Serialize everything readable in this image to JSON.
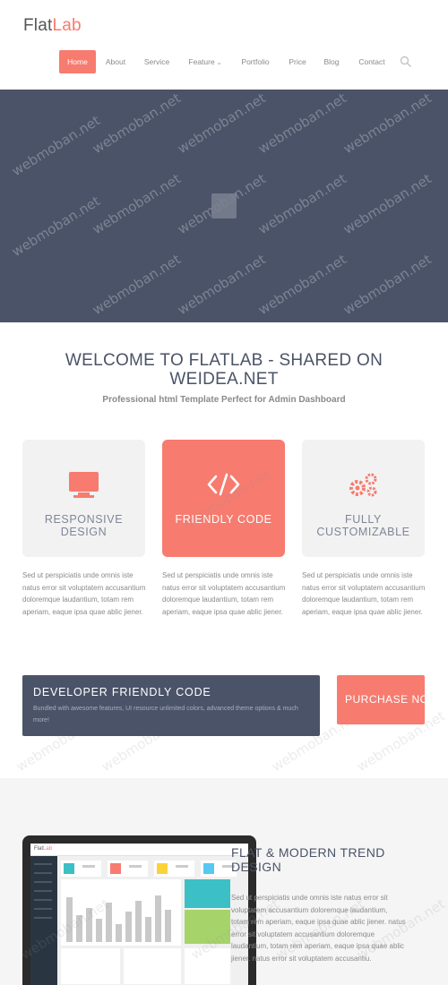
{
  "header": {
    "logo_main": "Flat",
    "logo_accent": "Lab",
    "nav": [
      {
        "label": "Home",
        "active": true
      },
      {
        "label": "About"
      },
      {
        "label": "Service"
      },
      {
        "label": "Feature",
        "has_dropdown": true
      },
      {
        "label": "Portfolio"
      },
      {
        "label": "Price"
      },
      {
        "label": "Blog"
      },
      {
        "label": "Contact"
      }
    ],
    "search_icon": "search-icon"
  },
  "watermark": "webmoban.net",
  "welcome": {
    "title": "WELCOME TO FLATLAB - SHARED ON WEIDEA.NET",
    "subtitle": "Professional html Template Perfect for Admin Dashboard"
  },
  "features": [
    {
      "title": "RESPONSIVE DESIGN",
      "icon": "monitor-icon",
      "highlighted": false,
      "text": "Sed ut perspiciatis unde omnis iste natus error sit voluptatem accusantium doloremque laudantium, totam rem aperiam, eaque ipsa quae ablic jiener."
    },
    {
      "title": "FRIENDLY CODE",
      "icon": "code-icon",
      "highlighted": true,
      "text": "Sed ut perspiciatis unde omnis iste natus error sit voluptatem accusantium doloremque laudantium, totam rem aperiam, eaque ipsa quae ablic jiener."
    },
    {
      "title": "FULLY CUSTOMIZABLE",
      "icon": "gears-icon",
      "highlighted": false,
      "text": "Sed ut perspiciatis unde omnis iste natus error sit voluptatem accusantium doloremque laudantium, totam rem aperiam, eaque ipsa quae ablic jiener."
    }
  ],
  "cta": {
    "title": "DEVELOPER FRIENDLY CODE",
    "text": "Bundled with awesome features, UI resource unlimited colors, advanced theme options & much more!",
    "button": "PURCHASE NOW"
  },
  "bottom": {
    "title": "FLAT & MODERN TREND DESIGN",
    "text": "Sed ut perspiciatis unde omnis iste natus error sit voluptatem accusantium doloremque laudantium, totam rem aperiam, eaque ipsa quae ablic jiener. natus error sit voluptatem accusantium doloremque laudantium, totam rem aperiam, eaque ipsa quae ablic jiener. natus error sit voluptatem accusantiu."
  },
  "mock_screen": {
    "logo_main": "Flat",
    "logo_accent": "Lab"
  },
  "colors": {
    "accent": "#f77b6f",
    "dark": "#4a5368",
    "light_box": "#f2f2f2",
    "teal": "#3cc0c5",
    "green": "#a7d36b"
  }
}
